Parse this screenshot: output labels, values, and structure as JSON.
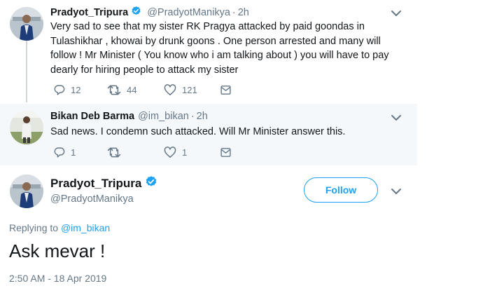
{
  "tweets": [
    {
      "name": "Pradyot_Tripura",
      "handle": "@PradyotManikya",
      "separator": "·",
      "time": "2h",
      "text": "Very sad to see that my sister RK Pragya attacked by paid goondas in Tulashikhar , khowai by drunk goons . One person arrested  and many will follow ! Mr Minister ( You know who i am talking about ) you will have to pay dearly for hiring people to attack my sister",
      "replies": "12",
      "retweets": "44",
      "likes": "121",
      "verified": true
    },
    {
      "name": "Bikan Deb Barma",
      "handle": "@im_bikan",
      "separator": "·",
      "time": "2h",
      "text": "Sad news. I condemn such attacked. Will Mr Minister answer this.",
      "replies": "1",
      "retweets": "",
      "likes": "1",
      "verified": false
    }
  ],
  "focus": {
    "name": "Pradyot_Tripura",
    "handle": "@PradyotManikya",
    "follow_label": "Follow",
    "replying_prefix": "Replying to",
    "replying_to": "@im_bikan",
    "text": "Ask mevar !",
    "timestamp": "2:50 AM - 18 Apr 2019"
  },
  "icons": {
    "verified": "verified-badge-icon",
    "reply": "reply-icon",
    "retweet": "retweet-icon",
    "like": "heart-icon",
    "message": "direct-message-icon",
    "caret": "chevron-down-icon"
  },
  "colors": {
    "accent": "#1da1f2",
    "muted": "#657786",
    "reply_background": "#f5f8fa"
  }
}
